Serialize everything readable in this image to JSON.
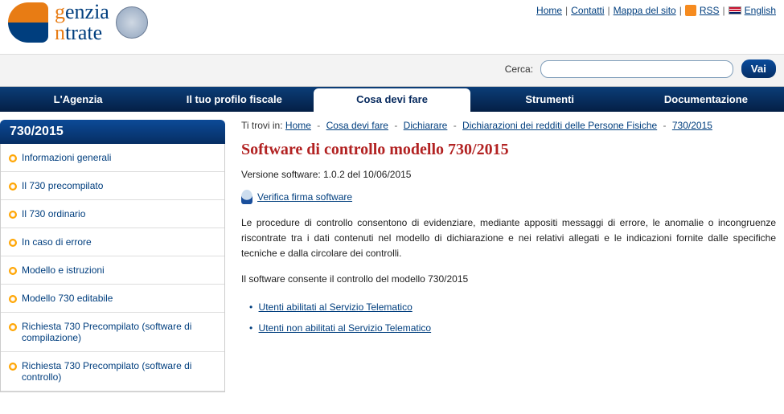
{
  "header": {
    "logo_line1_a": "g",
    "logo_line1_b": "enzia",
    "logo_line2_a": "n",
    "logo_line2_b": "trate",
    "top_links": {
      "home": "Home",
      "contatti": "Contatti",
      "mappa": "Mappa del sito",
      "rss": "RSS",
      "english": "English"
    }
  },
  "search": {
    "label": "Cerca:",
    "button": "Vai"
  },
  "mainnav": {
    "agenzia": "L'Agenzia",
    "profilo": "Il tuo profilo fiscale",
    "cosa": "Cosa devi fare",
    "strumenti": "Strumenti",
    "documentazione": "Documentazione"
  },
  "sidebar": {
    "title": "730/2015",
    "items": [
      "Informazioni generali",
      "Il 730 precompilato",
      "Il 730 ordinario",
      "In caso di errore",
      "Modello e istruzioni",
      "Modello 730 editabile",
      "Richiesta 730 Precompilato (software di compilazione)",
      "Richiesta 730 Precompilato (software di controllo)"
    ]
  },
  "breadcrumb": {
    "prefix": "Ti trovi in:",
    "home": "Home",
    "cosa": "Cosa devi fare",
    "dichiarare": "Dichiarare",
    "redditi": "Dichiarazioni dei redditi delle Persone Fisiche",
    "last": "730/2015"
  },
  "page": {
    "title": "Software di controllo modello 730/2015",
    "version": "Versione software: 1.0.2 del 10/06/2015",
    "verify": "Verifica firma software",
    "para1": "Le procedure di controllo consentono di evidenziare, mediante appositi messaggi di errore, le anomalie o incongruenze riscontrate tra i dati contenuti nel modello di dichiarazione e nei relativi allegati e le indicazioni fornite dalle specifiche tecniche e dalla circolare dei controlli.",
    "para2": "Il software consente il controllo del modello 730/2015",
    "links": {
      "abilitati": "Utenti abilitati al Servizio Telematico",
      "non_abilitati": "Utenti non abilitati al Servizio Telematico"
    }
  }
}
